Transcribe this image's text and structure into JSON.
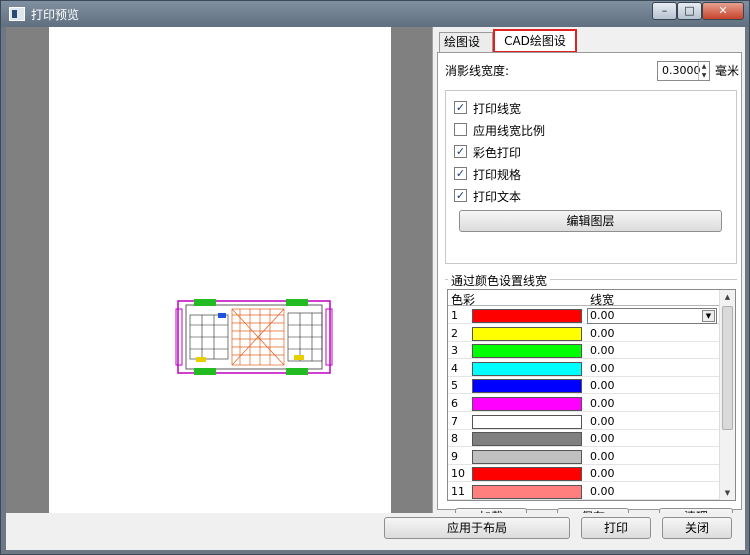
{
  "window": {
    "title": "打印预览"
  },
  "tabs": [
    {
      "label": "绘图设置"
    },
    {
      "label": "CAD绘图设置"
    }
  ],
  "line_width": {
    "label": "消影线宽度:",
    "value": "0.3000",
    "unit": "毫米"
  },
  "checkboxes": [
    {
      "label": "打印线宽",
      "checked": true
    },
    {
      "label": "应用线宽比例",
      "checked": false
    },
    {
      "label": "彩色打印",
      "checked": true
    },
    {
      "label": "打印规格",
      "checked": true
    },
    {
      "label": "打印文本",
      "checked": true
    }
  ],
  "edit_layer_button": "编辑图层",
  "color_group_title": "通过颜色设置线宽",
  "table": {
    "headers": [
      "色彩",
      "线宽"
    ],
    "rows": [
      {
        "num": "1",
        "color": "#ff0000",
        "value": "0.00"
      },
      {
        "num": "2",
        "color": "#ffff00",
        "value": "0.00"
      },
      {
        "num": "3",
        "color": "#00ff00",
        "value": "0.00"
      },
      {
        "num": "4",
        "color": "#00ffff",
        "value": "0.00"
      },
      {
        "num": "5",
        "color": "#0000ff",
        "value": "0.00"
      },
      {
        "num": "6",
        "color": "#ff00ff",
        "value": "0.00"
      },
      {
        "num": "7",
        "color": "#ffffff",
        "value": "0.00"
      },
      {
        "num": "8",
        "color": "#808080",
        "value": "0.00"
      },
      {
        "num": "9",
        "color": "#c0c0c0",
        "value": "0.00"
      },
      {
        "num": "10",
        "color": "#ff0000",
        "value": "0.00"
      },
      {
        "num": "11",
        "color": "#ff7f7f",
        "value": "0.00"
      }
    ]
  },
  "table_buttons": {
    "load": "加载",
    "save": "保存",
    "clear": "清理"
  },
  "bottom_buttons": {
    "apply": "应用于布局",
    "print": "打印",
    "close": "关闭"
  },
  "colors": {
    "tab_highlight": "#e1201f",
    "preview_bg": "#808080"
  }
}
